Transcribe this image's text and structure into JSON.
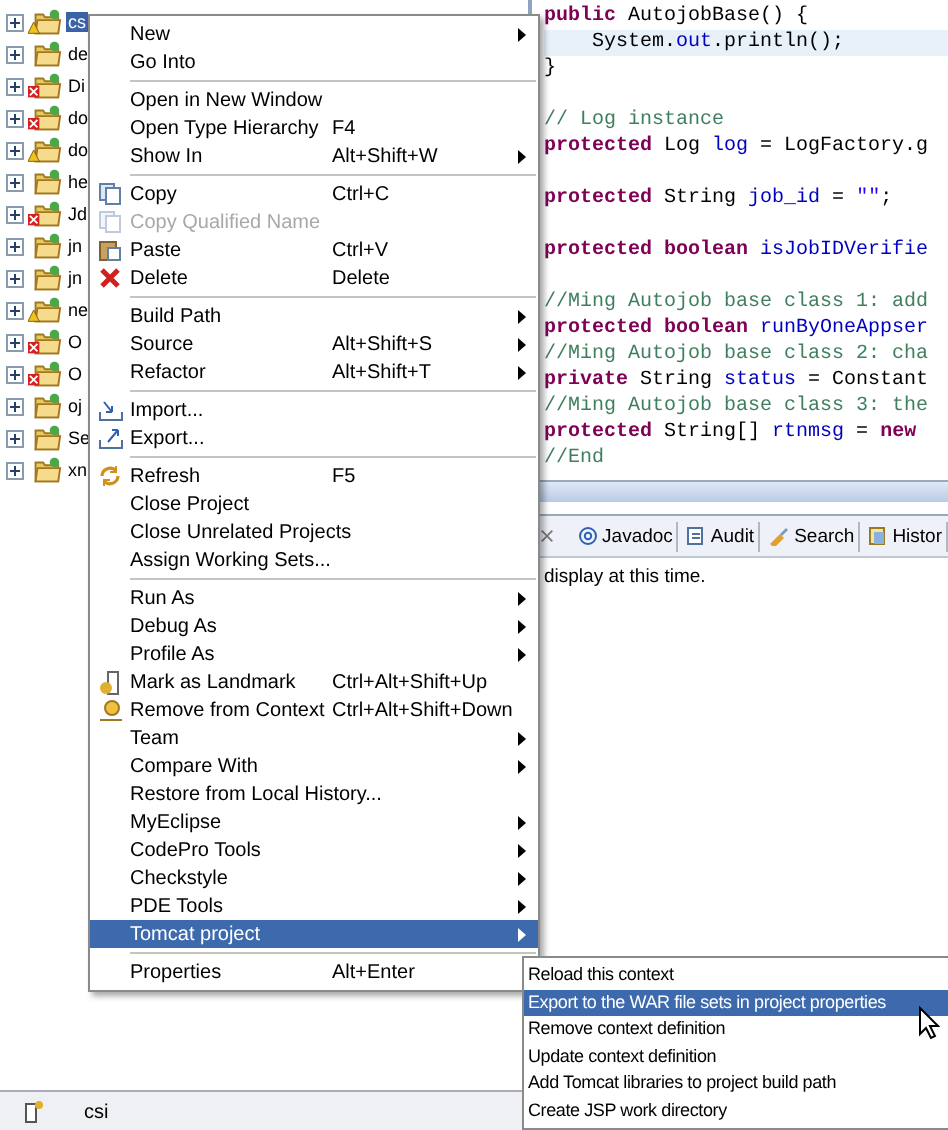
{
  "tree": {
    "items": [
      {
        "label": "cs",
        "error": false,
        "warning": true,
        "selected": true
      },
      {
        "label": "de",
        "error": false,
        "warning": false,
        "selected": false
      },
      {
        "label": "Di",
        "error": true,
        "warning": false,
        "selected": false
      },
      {
        "label": "do",
        "error": true,
        "warning": false,
        "selected": false
      },
      {
        "label": "do",
        "error": false,
        "warning": true,
        "selected": false
      },
      {
        "label": "he",
        "error": false,
        "warning": false,
        "selected": false
      },
      {
        "label": "Jd",
        "error": true,
        "warning": false,
        "selected": false
      },
      {
        "label": "jn",
        "error": false,
        "warning": false,
        "selected": false
      },
      {
        "label": "jn",
        "error": false,
        "warning": false,
        "selected": false
      },
      {
        "label": "ne",
        "error": false,
        "warning": true,
        "selected": false
      },
      {
        "label": "O",
        "error": true,
        "warning": false,
        "selected": false
      },
      {
        "label": "O",
        "error": true,
        "warning": false,
        "selected": false
      },
      {
        "label": "oj",
        "error": false,
        "warning": false,
        "selected": false
      },
      {
        "label": "Se",
        "error": false,
        "warning": false,
        "selected": false
      },
      {
        "label": "xn",
        "error": false,
        "warning": false,
        "selected": false
      }
    ]
  },
  "editor": {
    "lines": [
      {
        "current": false,
        "segments": [
          {
            "kind": "keyword",
            "text": "public "
          },
          {
            "kind": "plain",
            "text": "AutojobBase() {"
          }
        ]
      },
      {
        "current": true,
        "segments": [
          {
            "kind": "plain",
            "text": "    System."
          },
          {
            "kind": "field",
            "text": "out"
          },
          {
            "kind": "plain",
            "text": ".println();"
          }
        ]
      },
      {
        "current": false,
        "segments": [
          {
            "kind": "plain",
            "text": "}"
          }
        ]
      },
      {
        "current": false
      },
      {
        "current": false,
        "segments": [
          {
            "kind": "comment",
            "text": "// Log instance"
          }
        ]
      },
      {
        "current": false,
        "segments": [
          {
            "kind": "keyword",
            "text": "protected "
          },
          {
            "kind": "plain",
            "text": "Log "
          },
          {
            "kind": "field",
            "text": "log"
          },
          {
            "kind": "plain",
            "text": " = LogFactory.g"
          }
        ]
      },
      {
        "current": false
      },
      {
        "current": false,
        "segments": [
          {
            "kind": "keyword",
            "text": "protected "
          },
          {
            "kind": "plain",
            "text": "String "
          },
          {
            "kind": "field",
            "text": "job_id"
          },
          {
            "kind": "plain",
            "text": " = "
          },
          {
            "kind": "string",
            "text": "\"\""
          },
          {
            "kind": "plain",
            "text": ";"
          }
        ]
      },
      {
        "current": false
      },
      {
        "current": false,
        "segments": [
          {
            "kind": "keyword",
            "text": "protected boolean "
          },
          {
            "kind": "field",
            "text": "isJobIDVerifie"
          }
        ]
      },
      {
        "current": false
      },
      {
        "current": false,
        "segments": [
          {
            "kind": "comment",
            "text": "//Ming Autojob base class 1: add"
          }
        ]
      },
      {
        "current": false,
        "segments": [
          {
            "kind": "keyword",
            "text": "protected boolean "
          },
          {
            "kind": "field",
            "text": "runByOneAppser"
          }
        ]
      },
      {
        "current": false,
        "segments": [
          {
            "kind": "comment",
            "text": "//Ming Autojob base class 2: cha"
          }
        ]
      },
      {
        "current": false,
        "segments": [
          {
            "kind": "keyword",
            "text": "private "
          },
          {
            "kind": "plain",
            "text": "String "
          },
          {
            "kind": "field",
            "text": "status"
          },
          {
            "kind": "plain",
            "text": " = Constant"
          }
        ]
      },
      {
        "current": false,
        "segments": [
          {
            "kind": "comment",
            "text": "//Ming Autojob base class 3: the"
          }
        ]
      },
      {
        "current": false,
        "segments": [
          {
            "kind": "keyword",
            "text": "protected "
          },
          {
            "kind": "plain",
            "text": "String[] "
          },
          {
            "kind": "field",
            "text": "rtnmsg"
          },
          {
            "kind": "plain",
            "text": " = "
          },
          {
            "kind": "keyword",
            "text": "new"
          }
        ]
      },
      {
        "current": false,
        "segments": [
          {
            "kind": "comment",
            "text": "//End"
          }
        ]
      }
    ]
  },
  "bottom_panel": {
    "tabs": [
      {
        "label": "Javadoc",
        "selected": false
      },
      {
        "label": "Audit",
        "selected": false
      },
      {
        "label": "Search",
        "selected": false
      },
      {
        "label": "Histor",
        "selected": false
      }
    ],
    "message": "display at this time."
  },
  "status_bar": {
    "text": "csi"
  },
  "context_menu": {
    "groups": [
      [
        {
          "label": "New",
          "submenu": true,
          "disabled": false,
          "selected": false
        },
        {
          "label": "Go Into",
          "disabled": false,
          "selected": false
        }
      ],
      [
        {
          "label": "Open in New Window",
          "disabled": false,
          "selected": false
        },
        {
          "label": "Open Type Hierarchy",
          "shortcut": "F4",
          "disabled": false,
          "selected": false
        },
        {
          "label": "Show In",
          "shortcut": "Alt+Shift+W",
          "submenu": true,
          "disabled": false,
          "selected": false
        }
      ],
      [
        {
          "label": "Copy",
          "shortcut": "Ctrl+C",
          "disabled": false,
          "selected": false
        },
        {
          "label": "Copy Qualified Name",
          "disabled": true,
          "selected": false
        },
        {
          "label": "Paste",
          "shortcut": "Ctrl+V",
          "disabled": false,
          "selected": false
        },
        {
          "label": "Delete",
          "shortcut": "Delete",
          "disabled": false,
          "selected": false
        }
      ],
      [
        {
          "label": "Build Path",
          "submenu": true,
          "disabled": false,
          "selected": false
        },
        {
          "label": "Source",
          "shortcut": "Alt+Shift+S",
          "submenu": true,
          "disabled": false,
          "selected": false
        },
        {
          "label": "Refactor",
          "shortcut": "Alt+Shift+T",
          "submenu": true,
          "disabled": false,
          "selected": false
        }
      ],
      [
        {
          "label": "Import...",
          "disabled": false,
          "selected": false
        },
        {
          "label": "Export...",
          "disabled": false,
          "selected": false
        }
      ],
      [
        {
          "label": "Refresh",
          "shortcut": "F5",
          "disabled": false,
          "selected": false
        },
        {
          "label": "Close Project",
          "disabled": false,
          "selected": false
        },
        {
          "label": "Close Unrelated Projects",
          "disabled": false,
          "selected": false
        },
        {
          "label": "Assign Working Sets...",
          "disabled": false,
          "selected": false
        }
      ],
      [
        {
          "label": "Run As",
          "submenu": true,
          "disabled": false,
          "selected": false
        },
        {
          "label": "Debug As",
          "submenu": true,
          "disabled": false,
          "selected": false
        },
        {
          "label": "Profile As",
          "submenu": true,
          "disabled": false,
          "selected": false
        },
        {
          "label": "Mark as Landmark",
          "shortcut": "Ctrl+Alt+Shift+Up",
          "disabled": false,
          "selected": false
        },
        {
          "label": "Remove from Context",
          "shortcut": "Ctrl+Alt+Shift+Down",
          "disabled": false,
          "selected": false
        },
        {
          "label": "Team",
          "submenu": true,
          "disabled": false,
          "selected": false
        },
        {
          "label": "Compare With",
          "submenu": true,
          "disabled": false,
          "selected": false
        },
        {
          "label": "Restore from Local History...",
          "disabled": false,
          "selected": false
        },
        {
          "label": "MyEclipse",
          "submenu": true,
          "disabled": false,
          "selected": false
        },
        {
          "label": "CodePro Tools",
          "submenu": true,
          "disabled": false,
          "selected": false
        },
        {
          "label": "Checkstyle",
          "submenu": true,
          "disabled": false,
          "selected": false
        },
        {
          "label": "PDE Tools",
          "submenu": true,
          "disabled": false,
          "selected": false
        },
        {
          "label": "Tomcat project",
          "submenu": true,
          "disabled": false,
          "selected": true
        }
      ],
      [
        {
          "label": "Properties",
          "shortcut": "Alt+Enter",
          "disabled": false,
          "selected": false
        }
      ]
    ]
  },
  "submenu": {
    "items": [
      {
        "label": "Reload this context",
        "selected": false
      },
      {
        "label": "Export to the WAR file sets in project properties",
        "selected": true
      },
      {
        "label": "Remove context definition",
        "selected": false
      },
      {
        "label": "Update context definition",
        "selected": false
      },
      {
        "label": "Add Tomcat libraries to project build path",
        "selected": false
      },
      {
        "label": "Create JSP work directory",
        "selected": false
      }
    ]
  }
}
